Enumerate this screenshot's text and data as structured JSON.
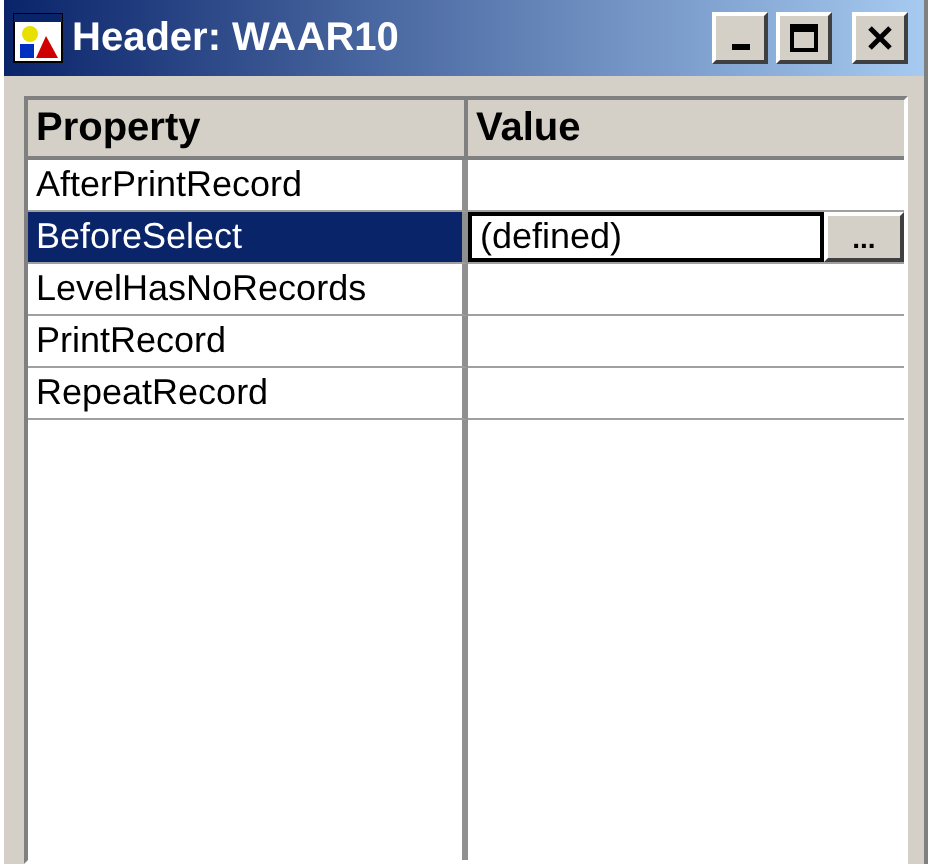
{
  "window": {
    "title": "Header: WAAR10"
  },
  "table": {
    "columns": [
      "Property",
      "Value"
    ],
    "rows": [
      {
        "property": "AfterPrintRecord",
        "selected": false
      },
      {
        "property": "BeforeSelect",
        "value": "(defined)",
        "button": "...",
        "selected": true
      },
      {
        "property": "LevelHasNoRecords",
        "selected": false
      },
      {
        "property": "PrintRecord",
        "selected": false
      },
      {
        "property": "RepeatRecord",
        "selected": false
      }
    ]
  }
}
